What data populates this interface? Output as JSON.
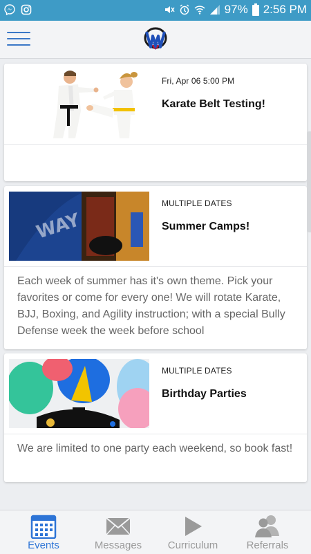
{
  "status_bar": {
    "battery": "97%",
    "time": "2:56 PM",
    "icons": [
      "messenger-icon",
      "instagram-icon",
      "mute-icon",
      "alarm-icon",
      "wifi-icon",
      "signal-icon",
      "battery-icon"
    ]
  },
  "app_bar": {
    "menu_icon": "hamburger-icon",
    "logo": "martial-arts-logo"
  },
  "events": [
    {
      "date": "Fri, Apr 06 5:00 PM",
      "title": "Karate Belt Testing!",
      "description": ""
    },
    {
      "date": "MULTIPLE DATES",
      "title": "Summer Camps!",
      "description": "Each week of summer has it's own theme. Pick your favorites or come for every one! We will rotate Karate, BJJ, Boxing, and Agility instruction; with a special Bully Defense week the week before school"
    },
    {
      "date": "MULTIPLE DATES",
      "title": "Birthday Parties",
      "description": "We are limited to one party each weekend, so book fast!"
    }
  ],
  "bottom_nav": {
    "items": [
      {
        "label": "Events",
        "icon": "calendar-icon",
        "active": true
      },
      {
        "label": "Messages",
        "icon": "envelope-icon",
        "active": false
      },
      {
        "label": "Curriculum",
        "icon": "play-icon",
        "active": false
      },
      {
        "label": "Referrals",
        "icon": "people-icon",
        "active": false
      }
    ]
  },
  "colors": {
    "status_bar": "#3e9bc6",
    "accent": "#2d74d6",
    "inactive": "#9a9a9a"
  }
}
